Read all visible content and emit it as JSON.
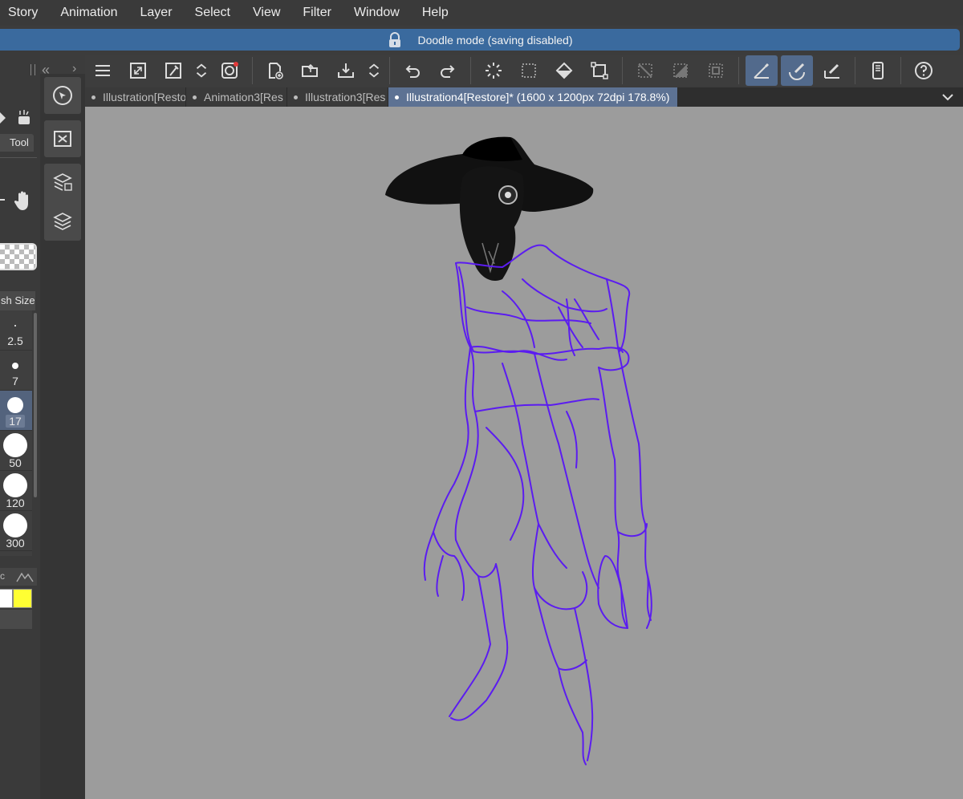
{
  "menubar": {
    "items": [
      "Story",
      "Animation",
      "Layer",
      "Select",
      "View",
      "Filter",
      "Window",
      "Help"
    ]
  },
  "banner": {
    "text": "Doodle mode (saving disabled)",
    "icon": "lock-icon"
  },
  "toolbar": {
    "buttons": [
      "menu-icon",
      "resize-icon",
      "eyedropper-icon",
      "updown-icon",
      "record-icon",
      "new-file-icon",
      "open-folder-icon",
      "save-icon",
      "updown-icon",
      "undo-icon",
      "redo-icon",
      "loading-icon",
      "select-area-icon",
      "fill-icon",
      "transform-icon",
      "deselect-icon",
      "invert-selection-icon",
      "selection-border-icon",
      "snap-ruler-icon",
      "snap-special-ruler-icon",
      "snap-grid-icon",
      "smartphone-icon",
      "help-icon"
    ]
  },
  "tabs": {
    "items": [
      {
        "label": "Illustration[Resto"
      },
      {
        "label": "Animation3[Res"
      },
      {
        "label": "Illustration3[Res"
      },
      {
        "label": "Illustration4[Restore]* (1600 x 1200px 72dpi 178.8%)"
      }
    ],
    "active_index": 3
  },
  "left_panel": {
    "tool_tab": "Tool",
    "brush_size_tab": "sh Size",
    "brush_sizes": [
      "2.5",
      "7",
      "17",
      "50",
      "120",
      "300"
    ],
    "selected_brush_size": "17",
    "color_tab_label": "c",
    "colors": {
      "main": "#ffffff",
      "sub": "#ffff33"
    }
  },
  "strip": {
    "buttons": [
      "navigator-icon",
      "close-panel-icon",
      "layer-property-icon",
      "layers-icon"
    ]
  },
  "colors": {
    "banner": "#3a6a9e",
    "active_tab": "#5d7293",
    "canvas": "#9c9c9c",
    "sketch_stroke": "#5b1cf0"
  }
}
